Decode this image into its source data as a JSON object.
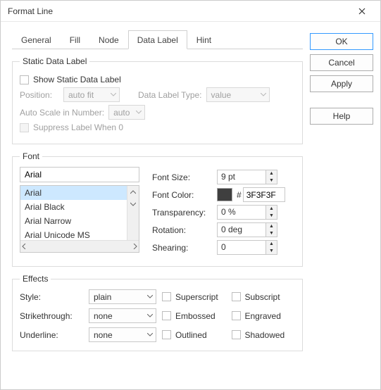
{
  "window": {
    "title": "Format Line"
  },
  "tabs": [
    "General",
    "Fill",
    "Node",
    "Data Label",
    "Hint"
  ],
  "active_tab": "Data Label",
  "buttons": {
    "ok": "OK",
    "cancel": "Cancel",
    "apply": "Apply",
    "help": "Help"
  },
  "static": {
    "legend": "Static Data Label",
    "show": "Show Static Data Label",
    "position_lbl": "Position:",
    "position_val": "auto fit",
    "type_lbl": "Data Label Type:",
    "type_val": "value",
    "autoscale_lbl": "Auto Scale in Number:",
    "autoscale_val": "auto",
    "suppress": "Suppress Label When 0"
  },
  "font": {
    "legend": "Font",
    "name": "Arial",
    "list": [
      "Arial",
      "Arial Black",
      "Arial Narrow",
      "Arial Unicode MS"
    ],
    "size_lbl": "Font Size:",
    "size_val": "9 pt",
    "color_lbl": "Font Color:",
    "color_hex": "3F3F3F",
    "hash": "#",
    "trans_lbl": "Transparency:",
    "trans_val": "0 %",
    "rot_lbl": "Rotation:",
    "rot_val": "0 deg",
    "shear_lbl": "Shearing:",
    "shear_val": "0"
  },
  "effects": {
    "legend": "Effects",
    "style_lbl": "Style:",
    "style_val": "plain",
    "strike_lbl": "Strikethrough:",
    "strike_val": "none",
    "under_lbl": "Underline:",
    "under_val": "none",
    "superscript": "Superscript",
    "subscript": "Subscript",
    "embossed": "Embossed",
    "engraved": "Engraved",
    "outlined": "Outlined",
    "shadowed": "Shadowed"
  }
}
